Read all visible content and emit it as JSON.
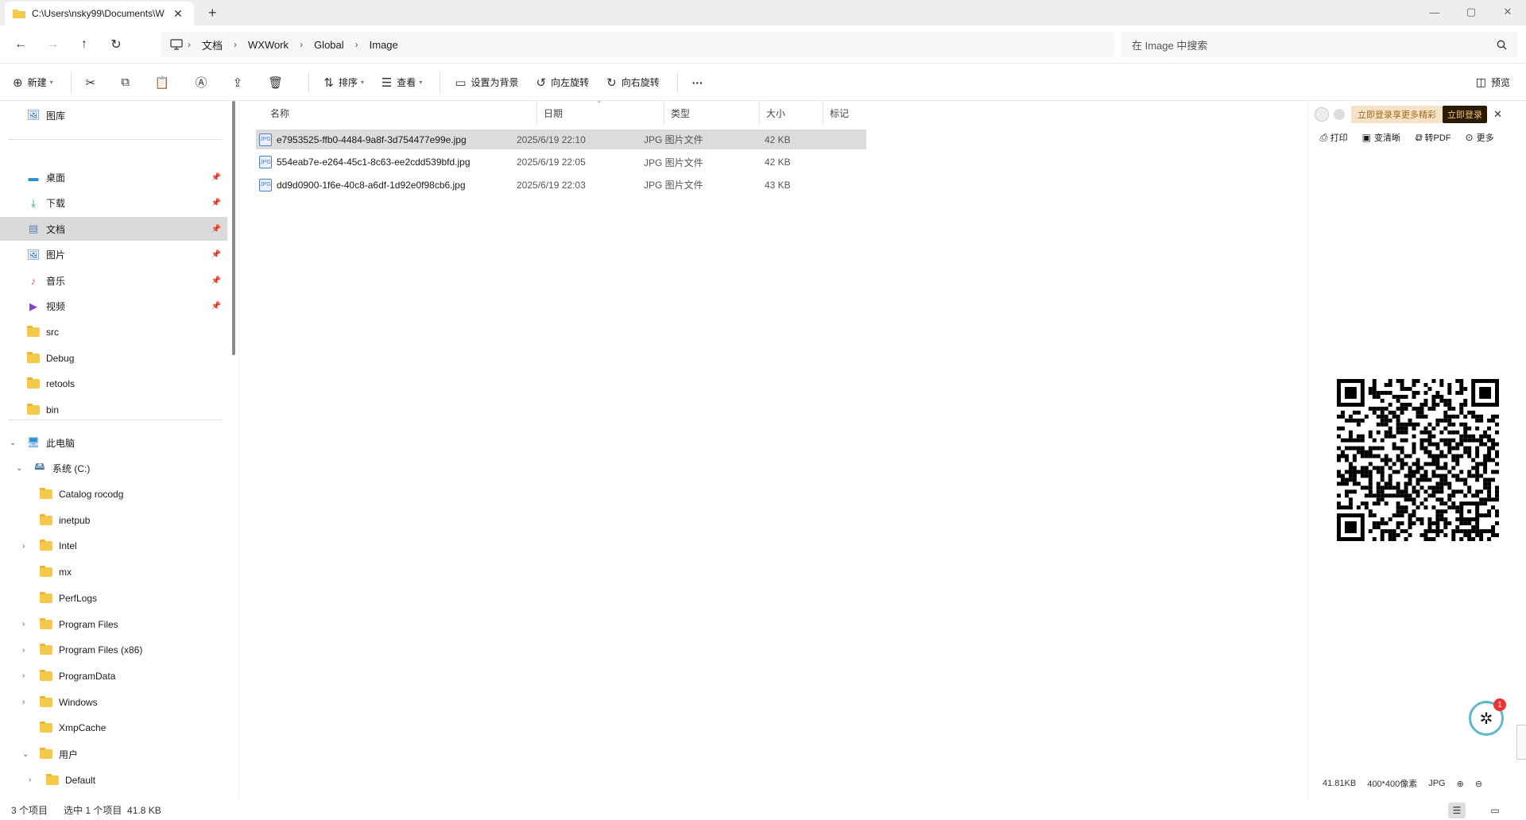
{
  "tab": {
    "title": "C:\\Users\\nsky99\\Documents\\W",
    "close": "✕",
    "new_tab": "+"
  },
  "window": {
    "minimize": "—",
    "maximize": "▢",
    "close": "✕"
  },
  "nav": {
    "back": "←",
    "forward": "→",
    "up": "↑",
    "refresh": "↻"
  },
  "breadcrumb": [
    "文档",
    "WXWork",
    "Global",
    "Image"
  ],
  "search": {
    "placeholder": "在 Image 中搜索"
  },
  "commands": {
    "new": "新建",
    "sort": "排序",
    "view": "查看",
    "set_background": "设置为背景",
    "rotate_left": "向左旋转",
    "rotate_right": "向右旋转",
    "more": "···",
    "preview": "预览"
  },
  "sidebar": {
    "gallery": "图库",
    "quick": [
      {
        "label": "桌面",
        "icon": "desktop-icon",
        "pinned": true
      },
      {
        "label": "下载",
        "icon": "download-icon",
        "pinned": true
      },
      {
        "label": "文档",
        "icon": "document-icon",
        "pinned": true,
        "selected": true
      },
      {
        "label": "图片",
        "icon": "picture-icon",
        "pinned": true
      },
      {
        "label": "音乐",
        "icon": "music-icon",
        "pinned": true
      },
      {
        "label": "视频",
        "icon": "video-icon",
        "pinned": true
      },
      {
        "label": "src",
        "icon": "folder-icon"
      },
      {
        "label": "Debug",
        "icon": "folder-icon"
      },
      {
        "label": "retools",
        "icon": "folder-icon"
      },
      {
        "label": "bin",
        "icon": "folder-icon"
      }
    ],
    "this_pc": "此电脑",
    "drive": "系统 (C:)",
    "drive_folders": [
      {
        "label": "Catalog rocodg",
        "expandable": false
      },
      {
        "label": "inetpub",
        "expandable": false
      },
      {
        "label": "Intel",
        "expandable": true
      },
      {
        "label": "mx",
        "expandable": false
      },
      {
        "label": "PerfLogs",
        "expandable": false
      },
      {
        "label": "Program Files",
        "expandable": true
      },
      {
        "label": "Program Files (x86)",
        "expandable": true
      },
      {
        "label": "ProgramData",
        "expandable": true
      },
      {
        "label": "Windows",
        "expandable": true
      },
      {
        "label": "XmpCache",
        "expandable": false
      },
      {
        "label": "用户",
        "expandable": true,
        "expanded": true
      }
    ],
    "user_folders": [
      {
        "label": "Default"
      }
    ]
  },
  "columns": {
    "name": "名称",
    "date": "日期",
    "type": "类型",
    "size": "大小",
    "tag": "标记"
  },
  "files": [
    {
      "name": "e7953525-ffb0-4484-9a8f-3d754477e99e.jpg",
      "date": "2025/6/19 22:10",
      "type": "JPG 图片文件",
      "size": "42 KB",
      "selected": true
    },
    {
      "name": "554eab7e-e264-45c1-8c63-ee2cdd539bfd.jpg",
      "date": "2025/6/19 22:05",
      "type": "JPG 图片文件",
      "size": "42 KB"
    },
    {
      "name": "dd9d0900-1f6e-40c8-a6df-1d92e0f98cb6.jpg",
      "date": "2025/6/19 22:03",
      "type": "JPG 图片文件",
      "size": "43 KB"
    }
  ],
  "preview_pane": {
    "promo_text": "立即登录享更多精彩",
    "login_button": "立即登录",
    "tools": {
      "print": "打印",
      "clarify": "变清晰",
      "to_pdf": "转PDF",
      "more": "更多"
    },
    "file_size": "41.81KB",
    "dimensions": "400*400像素",
    "format": "JPG",
    "badge_count": "1"
  },
  "status": {
    "item_count": "3 个项目",
    "selected": "选中 1 个项目  41.8 KB"
  },
  "colors": {
    "folder": "#f7c94a",
    "selection": "#dcdcdc",
    "accent": "#4a7fd4"
  }
}
